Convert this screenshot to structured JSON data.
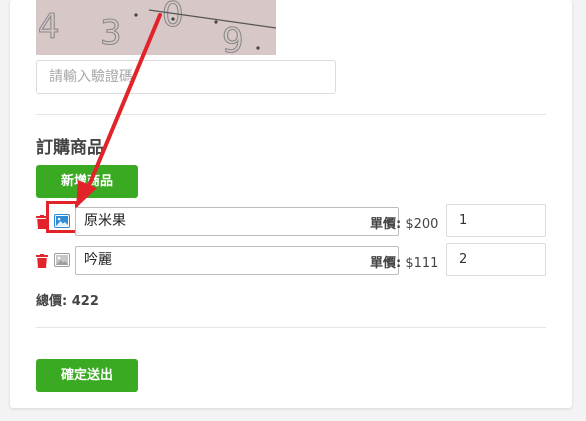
{
  "captcha": {
    "digits": [
      "4",
      "3",
      "0",
      "9"
    ],
    "input_placeholder": "請輸入驗證碼"
  },
  "order": {
    "section_title": "訂購商品",
    "add_button_label": "新增商品",
    "items": [
      {
        "product": "原米果",
        "price_label": "單價:",
        "price_value": "$200",
        "quantity": "1",
        "image_icon_highlighted": true
      },
      {
        "product": "吟麗",
        "price_label": "單價:",
        "price_value": "$111",
        "quantity": "2",
        "image_icon_highlighted": false
      }
    ],
    "total_label": "總價:",
    "total_value": "422",
    "submit_button_label": "確定送出"
  },
  "colors": {
    "primary_green": "#3aaa22",
    "delete_red": "#e2232a",
    "annotation_red": "#e2232a",
    "image_icon_active": "#2e8bd6",
    "image_icon_inactive": "#9e9e9e"
  },
  "icons": {
    "delete": "trash-icon",
    "image": "image-icon",
    "dropdown": "chevron-down-icon",
    "annotation": "arrow-annotation"
  }
}
